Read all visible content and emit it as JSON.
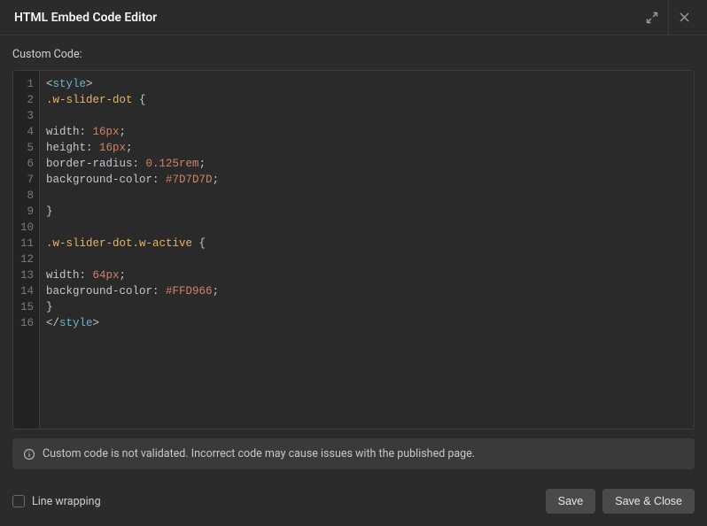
{
  "header": {
    "title": "HTML Embed Code Editor"
  },
  "label": "Custom Code:",
  "code": {
    "lines": [
      [
        {
          "t": "<",
          "c": "tok-punc"
        },
        {
          "t": "style",
          "c": "tok-tag"
        },
        {
          "t": ">",
          "c": "tok-punc"
        }
      ],
      [
        {
          "t": ".w-slider-dot",
          "c": "tok-sel"
        },
        {
          "t": " {",
          "c": "tok-punc"
        }
      ],
      [],
      [
        {
          "t": "width",
          "c": "tok-prop"
        },
        {
          "t": ": ",
          "c": "tok-punc"
        },
        {
          "t": "16px",
          "c": "tok-num"
        },
        {
          "t": ";",
          "c": "tok-punc"
        }
      ],
      [
        {
          "t": "height",
          "c": "tok-prop"
        },
        {
          "t": ": ",
          "c": "tok-punc"
        },
        {
          "t": "16px",
          "c": "tok-num"
        },
        {
          "t": ";",
          "c": "tok-punc"
        }
      ],
      [
        {
          "t": "border-radius",
          "c": "tok-prop"
        },
        {
          "t": ": ",
          "c": "tok-punc"
        },
        {
          "t": "0.125rem",
          "c": "tok-num"
        },
        {
          "t": ";",
          "c": "tok-punc"
        }
      ],
      [
        {
          "t": "background-color",
          "c": "tok-prop"
        },
        {
          "t": ": ",
          "c": "tok-punc"
        },
        {
          "t": "#7D7D7D",
          "c": "tok-color"
        },
        {
          "t": ";",
          "c": "tok-punc"
        }
      ],
      [],
      [
        {
          "t": "}",
          "c": "tok-punc"
        }
      ],
      [],
      [
        {
          "t": ".w-slider-dot.w-active",
          "c": "tok-sel"
        },
        {
          "t": " {",
          "c": "tok-punc"
        }
      ],
      [],
      [
        {
          "t": "width",
          "c": "tok-prop"
        },
        {
          "t": ": ",
          "c": "tok-punc"
        },
        {
          "t": "64px",
          "c": "tok-num"
        },
        {
          "t": ";",
          "c": "tok-punc"
        }
      ],
      [
        {
          "t": "background-color",
          "c": "tok-prop"
        },
        {
          "t": ": ",
          "c": "tok-punc"
        },
        {
          "t": "#FFD966",
          "c": "tok-color"
        },
        {
          "t": ";",
          "c": "tok-punc"
        }
      ],
      [
        {
          "t": "}",
          "c": "tok-punc"
        }
      ],
      [
        {
          "t": "</",
          "c": "tok-punc"
        },
        {
          "t": "style",
          "c": "tok-tag"
        },
        {
          "t": ">",
          "c": "tok-punc"
        }
      ]
    ]
  },
  "notice": "Custom code is not validated. Incorrect code may cause issues with the published page.",
  "footer": {
    "line_wrapping_label": "Line wrapping",
    "save_label": "Save",
    "save_close_label": "Save & Close"
  }
}
